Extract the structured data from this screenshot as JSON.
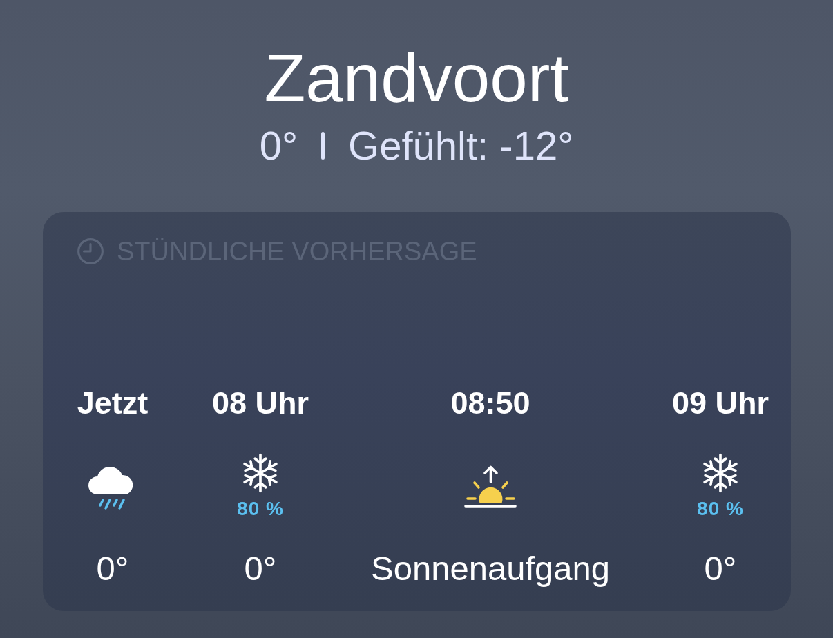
{
  "location": {
    "city": "Zandvoort",
    "temperature": "0°",
    "feels_like": "Gefühlt: -12°"
  },
  "hourly_forecast": {
    "title": "STÜNDLICHE VORHERSAGE",
    "items": [
      {
        "kind": "rain",
        "time": "Jetzt",
        "temperature": "0°"
      },
      {
        "kind": "snow",
        "time": "08 Uhr",
        "precipitation": "80 %",
        "temperature": "0°"
      },
      {
        "kind": "sunrise",
        "time": "08:50",
        "label": "Sonnenaufgang"
      },
      {
        "kind": "snow",
        "time": "09 Uhr",
        "precipitation": "80 %",
        "temperature": "0°"
      }
    ]
  }
}
